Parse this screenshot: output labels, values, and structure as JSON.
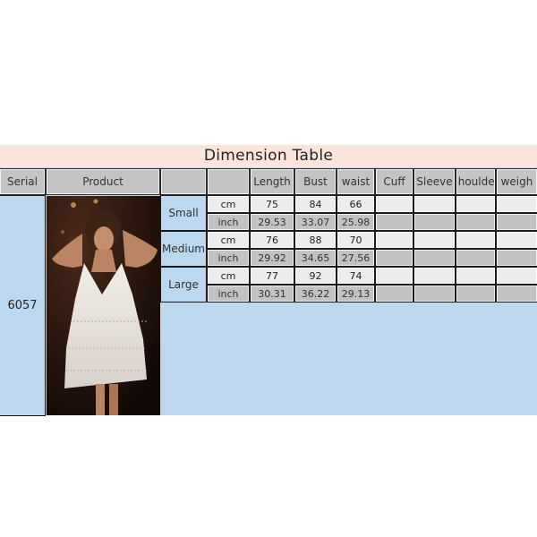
{
  "title": "Dimension Table",
  "headers": [
    "Serial",
    "Product",
    "",
    "",
    "Length",
    "Bust",
    "waist",
    "Cuff",
    "Sleeve",
    "shoulder",
    "weigh"
  ],
  "serial": "6057",
  "product_image": "woman-in-white-sequin-fringe-dress",
  "sizes": [
    {
      "name": "Small",
      "rows": [
        {
          "unit": "cm",
          "values": [
            "75",
            "84",
            "66",
            "",
            "",
            "",
            ""
          ]
        },
        {
          "unit": "inch",
          "values": [
            "29.53",
            "33.07",
            "25.98",
            "",
            "",
            "",
            ""
          ]
        }
      ]
    },
    {
      "name": "Medium",
      "rows": [
        {
          "unit": "cm",
          "values": [
            "76",
            "88",
            "70",
            "",
            "",
            "",
            ""
          ]
        },
        {
          "unit": "inch",
          "values": [
            "29.92",
            "34.65",
            "27.56",
            "",
            "",
            "",
            ""
          ]
        }
      ]
    },
    {
      "name": "Large",
      "rows": [
        {
          "unit": "cm",
          "values": [
            "77",
            "92",
            "74",
            "",
            "",
            "",
            ""
          ]
        },
        {
          "unit": "inch",
          "values": [
            "30.31",
            "36.22",
            "29.13",
            "",
            "",
            "",
            ""
          ]
        }
      ]
    }
  ],
  "colors": {
    "title_bg": "#fbe4da",
    "table_bg": "#bcd7ee",
    "header_bg": "#c4c4c4",
    "cm_row_bg": "#ececec",
    "inch_row_bg": "#c2c2c2"
  }
}
